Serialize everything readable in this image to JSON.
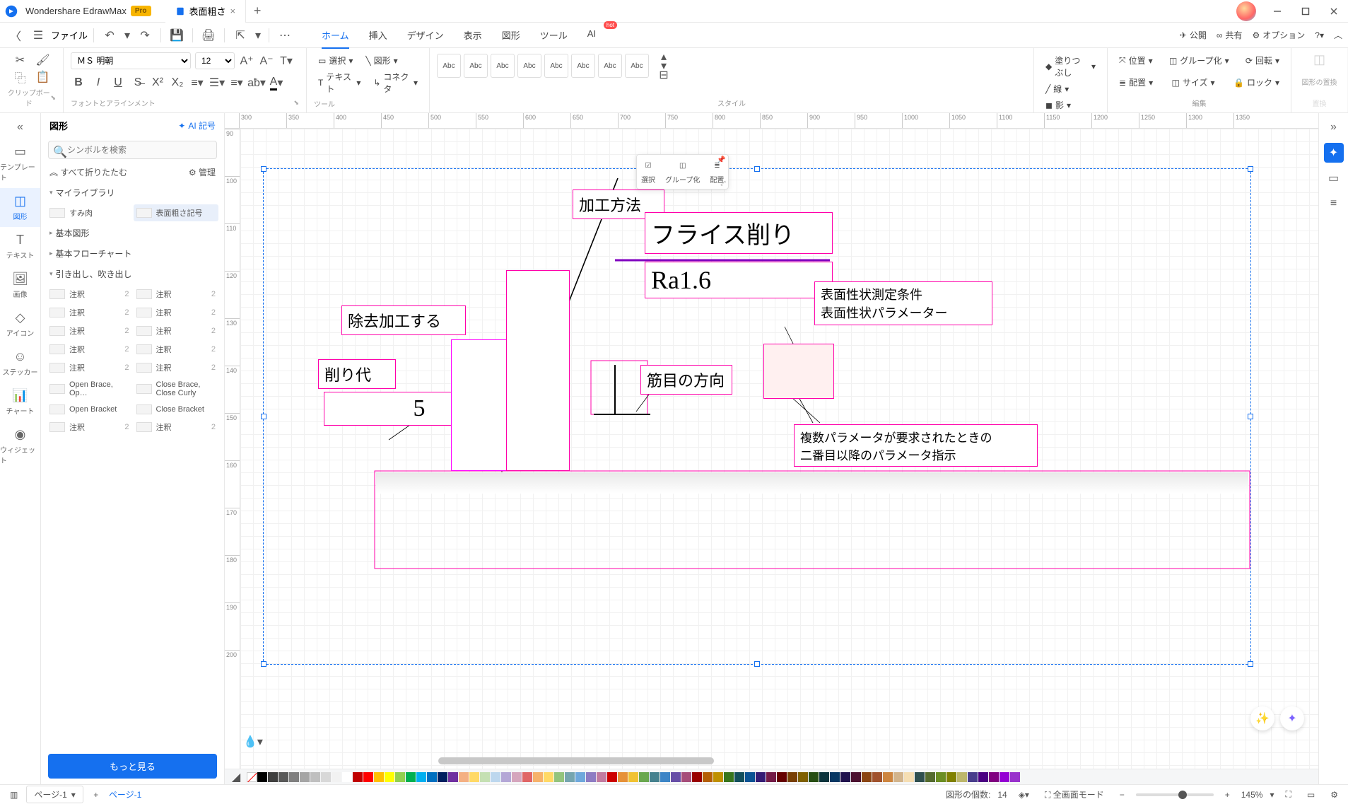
{
  "app": {
    "name": "Wondershare EdrawMax",
    "badge": "Pro",
    "tab_title": "表面粗さ"
  },
  "menubar": {
    "file": "ファイル",
    "items": [
      "ホーム",
      "挿入",
      "デザイン",
      "表示",
      "図形",
      "ツール",
      "AI"
    ],
    "active_index": 0,
    "hot_badge": "hot",
    "right": {
      "publish": "公開",
      "share": "共有",
      "options": "オプション"
    }
  },
  "ribbon": {
    "clipboard_label": "クリップボード",
    "font_name": "ＭＳ 明朝",
    "font_size": "12",
    "font_align_label": "フォントとアラインメント",
    "tools": {
      "select": "選択",
      "shape": "図形",
      "text": "テキスト",
      "connector": "コネクタ",
      "label": "ツール"
    },
    "style": {
      "label": "スタイル",
      "sample": "Abc"
    },
    "shape_props": {
      "fill": "塗りつぶし",
      "line": "線",
      "shadow": "影"
    },
    "edit": {
      "pos": "位置",
      "group": "グループ化",
      "rotate": "回転",
      "align": "配置",
      "size": "サイズ",
      "lock": "ロック",
      "label": "編集"
    },
    "replace": {
      "title": "図形の置換",
      "label": "置換"
    }
  },
  "leftrail": {
    "items": [
      "テンプレート",
      "図形",
      "テキスト",
      "画像",
      "アイコン",
      "ステッカー",
      "チャート",
      "ウィジェット"
    ],
    "active_index": 1
  },
  "shapes_panel": {
    "title": "図形",
    "ai": "AI 記号",
    "search_placeholder": "シンボルを検索",
    "collapse_all": "すべて折りたたむ",
    "manage": "管理",
    "categories": [
      "マイライブラリ",
      "基本図形",
      "基本フローチャート",
      "引き出し、吹き出し"
    ],
    "mylib_items": [
      {
        "label": "すみ肉"
      },
      {
        "label": "表面粗さ記号",
        "selected": true
      }
    ],
    "callout_items": [
      {
        "l": "注釈",
        "n": "2"
      },
      {
        "l": "注釈",
        "n": "2"
      },
      {
        "l": "注釈",
        "n": "2"
      },
      {
        "l": "注釈",
        "n": "2"
      },
      {
        "l": "注釈",
        "n": "2"
      },
      {
        "l": "注釈",
        "n": "2"
      },
      {
        "l": "注釈",
        "n": "2"
      },
      {
        "l": "注釈",
        "n": "2"
      },
      {
        "l": "注釈",
        "n": "2"
      },
      {
        "l": "注釈",
        "n": "2"
      },
      {
        "l": "Open Brace, Op…",
        "n": ""
      },
      {
        "l": "Close Brace, Close Curly",
        "n": ""
      },
      {
        "l": "Open Bracket",
        "n": ""
      },
      {
        "l": "Close Bracket",
        "n": ""
      },
      {
        "l": "注釈",
        "n": "2"
      },
      {
        "l": "注釈",
        "n": "2"
      }
    ],
    "more": "もっと見る"
  },
  "mini_toolbar": {
    "select": "選択",
    "group": "グループ化",
    "align": "配置"
  },
  "canvas": {
    "ruler_h": [
      300,
      350,
      400,
      450,
      500,
      550,
      600,
      650,
      700,
      750,
      800,
      850,
      900,
      950,
      1000,
      1050,
      1100,
      1150,
      1200,
      1250,
      1300,
      1350
    ],
    "ruler_v": [
      90,
      100,
      110,
      120,
      130,
      140,
      150,
      160,
      170,
      180,
      190,
      200
    ],
    "labels": {
      "method": "加工方法",
      "milling": "フライス削り",
      "ra": "Ra1.6",
      "surface_cond": "表面性状測定条件\n表面性状パラメーター",
      "remove": "除去加工する",
      "allowance": "削り代",
      "five": "5",
      "lay": "筋目の方向",
      "multi": "複数パラメータが要求されたときの\n二番目以降のパラメータ指示"
    }
  },
  "statusbar": {
    "page_current": "ページ-1",
    "page_label": "ページ-1",
    "shapes_count_label": "図形の個数:",
    "shapes_count": "14",
    "fullscreen": "全画面モード",
    "zoom": "145%"
  },
  "colors": [
    "#000000",
    "#3f3f3f",
    "#595959",
    "#7f7f7f",
    "#a5a5a5",
    "#bfbfbf",
    "#d8d8d8",
    "#f2f2f2",
    "#ffffff",
    "#c00000",
    "#ff0000",
    "#ffc000",
    "#ffff00",
    "#92d050",
    "#00b050",
    "#00b0f0",
    "#0070c0",
    "#002060",
    "#7030a0",
    "#f4b083",
    "#ffd966",
    "#c5e0b3",
    "#bdd7ee",
    "#b4a7d6",
    "#d5a6bd",
    "#e06666",
    "#f6b26b",
    "#ffd966",
    "#93c47d",
    "#76a5af",
    "#6fa8dc",
    "#8e7cc3",
    "#c27ba0",
    "#cc0000",
    "#e69138",
    "#f1c232",
    "#6aa84f",
    "#45818e",
    "#3d85c6",
    "#674ea7",
    "#a64d79",
    "#990000",
    "#b45f06",
    "#bf9000",
    "#38761d",
    "#134f5c",
    "#0b5394",
    "#351c75",
    "#741b47",
    "#660000",
    "#783f04",
    "#7f6000",
    "#274e13",
    "#0c343d",
    "#073763",
    "#20124d",
    "#4c1130",
    "#8b4513",
    "#a0522d",
    "#cd853f",
    "#d2b48c",
    "#f5deb3",
    "#2f4f4f",
    "#556b2f",
    "#6b8e23",
    "#808000",
    "#bdb76b",
    "#483d8b",
    "#4b0082",
    "#800080",
    "#9400d3",
    "#9932cc"
  ]
}
